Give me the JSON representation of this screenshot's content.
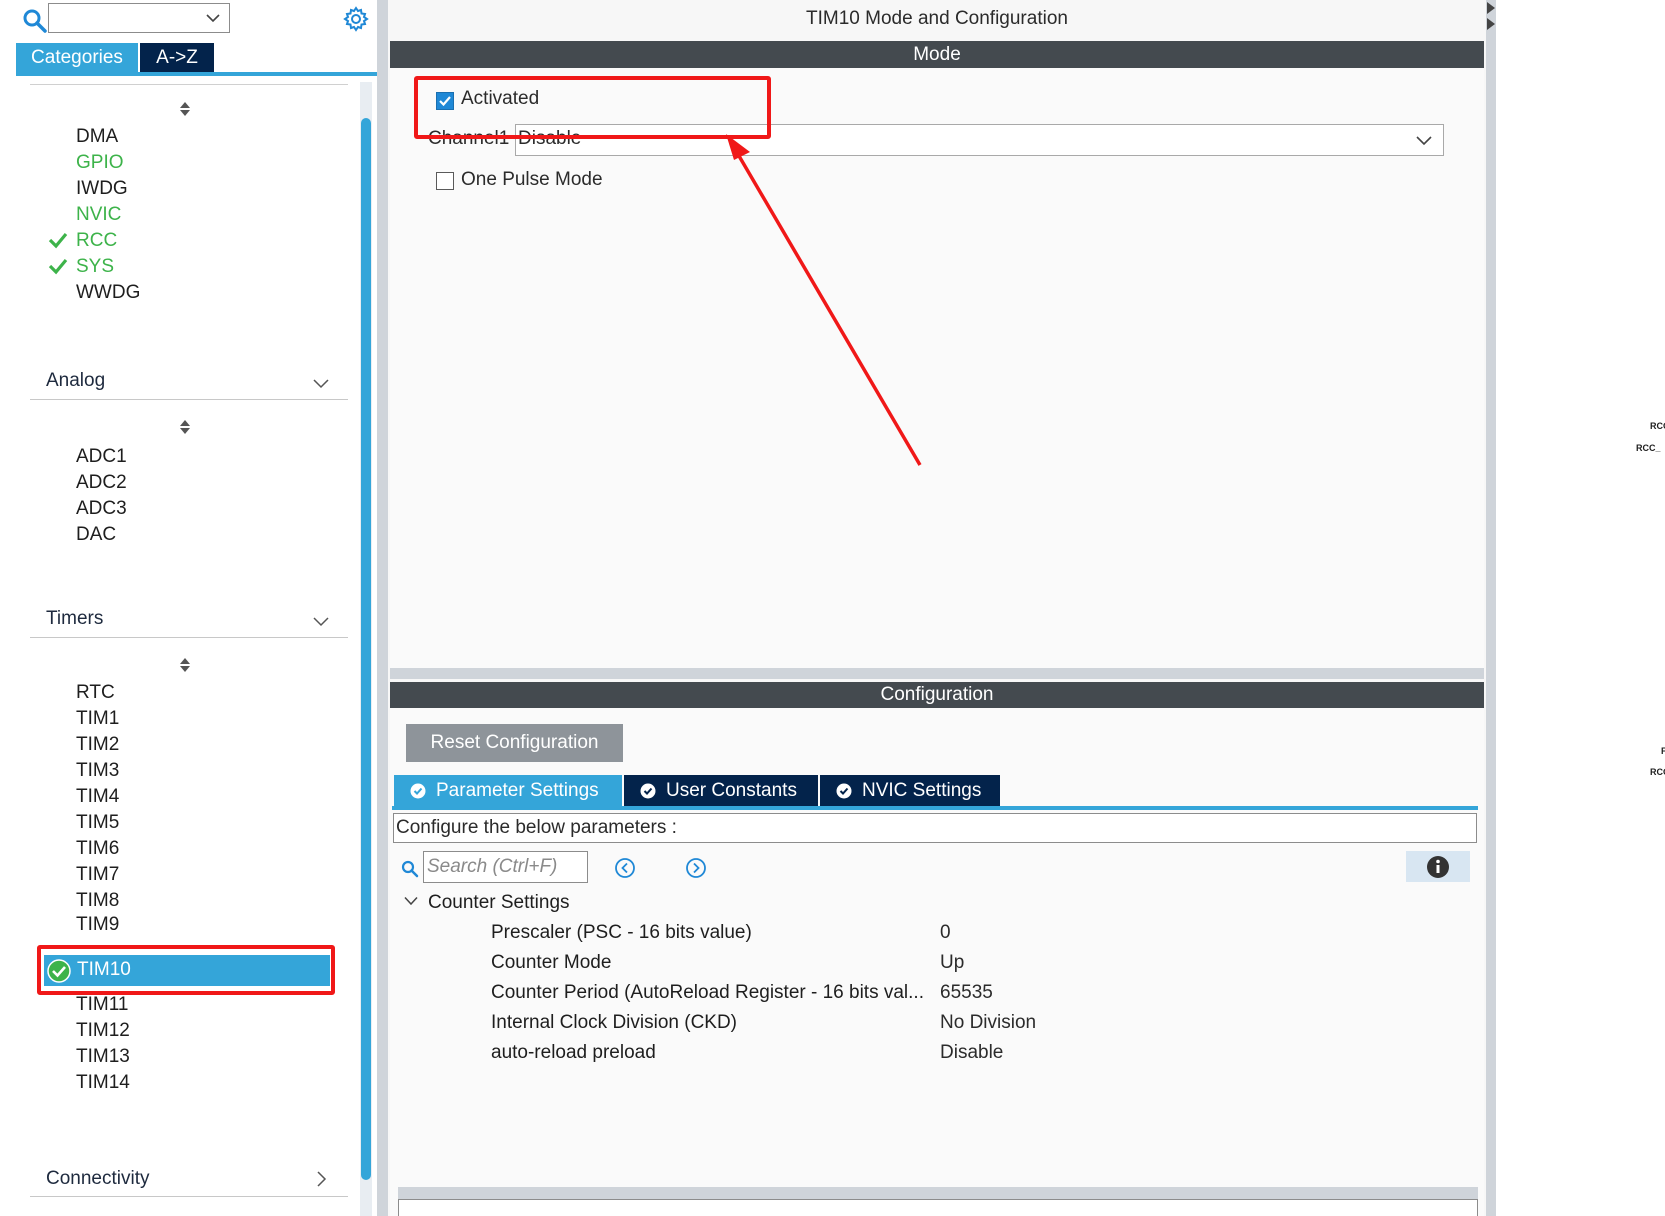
{
  "left": {
    "tabs": {
      "categories": "Categories",
      "az": "A->Z"
    },
    "system_core_items": [
      {
        "label": "DMA",
        "status": "none"
      },
      {
        "label": "GPIO",
        "status": "green"
      },
      {
        "label": "IWDG",
        "status": "none"
      },
      {
        "label": "NVIC",
        "status": "green"
      },
      {
        "label": "RCC",
        "status": "checked"
      },
      {
        "label": "SYS",
        "status": "checked"
      },
      {
        "label": "WWDG",
        "status": "none"
      }
    ],
    "analog": {
      "header": "Analog",
      "items": [
        "ADC1",
        "ADC2",
        "ADC3",
        "DAC"
      ]
    },
    "timers": {
      "header": "Timers",
      "items": [
        "RTC",
        "TIM1",
        "TIM2",
        "TIM3",
        "TIM4",
        "TIM5",
        "TIM6",
        "TIM7",
        "TIM8",
        "TIM9",
        "TIM10",
        "TIM11",
        "TIM12",
        "TIM13",
        "TIM14"
      ],
      "selected": "TIM10"
    },
    "connectivity": {
      "header": "Connectivity"
    }
  },
  "center": {
    "title": "TIM10 Mode and Configuration",
    "mode_header": "Mode",
    "activated_label": "Activated",
    "activated_checked": true,
    "channel1_label": "Channel1",
    "channel1_value": "Disable",
    "one_pulse_label": "One Pulse Mode",
    "one_pulse_checked": false,
    "config_header": "Configuration",
    "reset_button": "Reset Configuration",
    "tabs": [
      "Parameter Settings",
      "User Constants",
      "NVIC Settings"
    ],
    "active_tab": "Parameter Settings",
    "configure_below": "Configure the below parameters :",
    "search_placeholder": "Search (Ctrl+F)",
    "group_label": "Counter Settings",
    "params": [
      {
        "name": "Prescaler (PSC - 16 bits value)",
        "value": "0"
      },
      {
        "name": "Counter Mode",
        "value": "Up"
      },
      {
        "name": "Counter Period (AutoReload Register - 16 bits val...",
        "value": "65535"
      },
      {
        "name": "Internal Clock Division (CKD)",
        "value": "No Division"
      },
      {
        "name": "auto-reload preload",
        "value": "Disable"
      }
    ]
  },
  "right": {
    "pin_labels": [
      "RCC",
      "RCC_",
      "F",
      "RCC"
    ]
  },
  "colors": {
    "accent_blue": "#34a5d9",
    "dark_navy": "#03234b",
    "status_green": "#3db34a",
    "annotation_red": "#f01818",
    "header_bar": "#444a4f"
  },
  "icons": [
    "search-icon",
    "gear-icon",
    "chevron-down-icon",
    "check-icon",
    "sort-arrows-icon",
    "chevron-right-icon",
    "info-icon",
    "prev-result-icon",
    "next-result-icon"
  ]
}
